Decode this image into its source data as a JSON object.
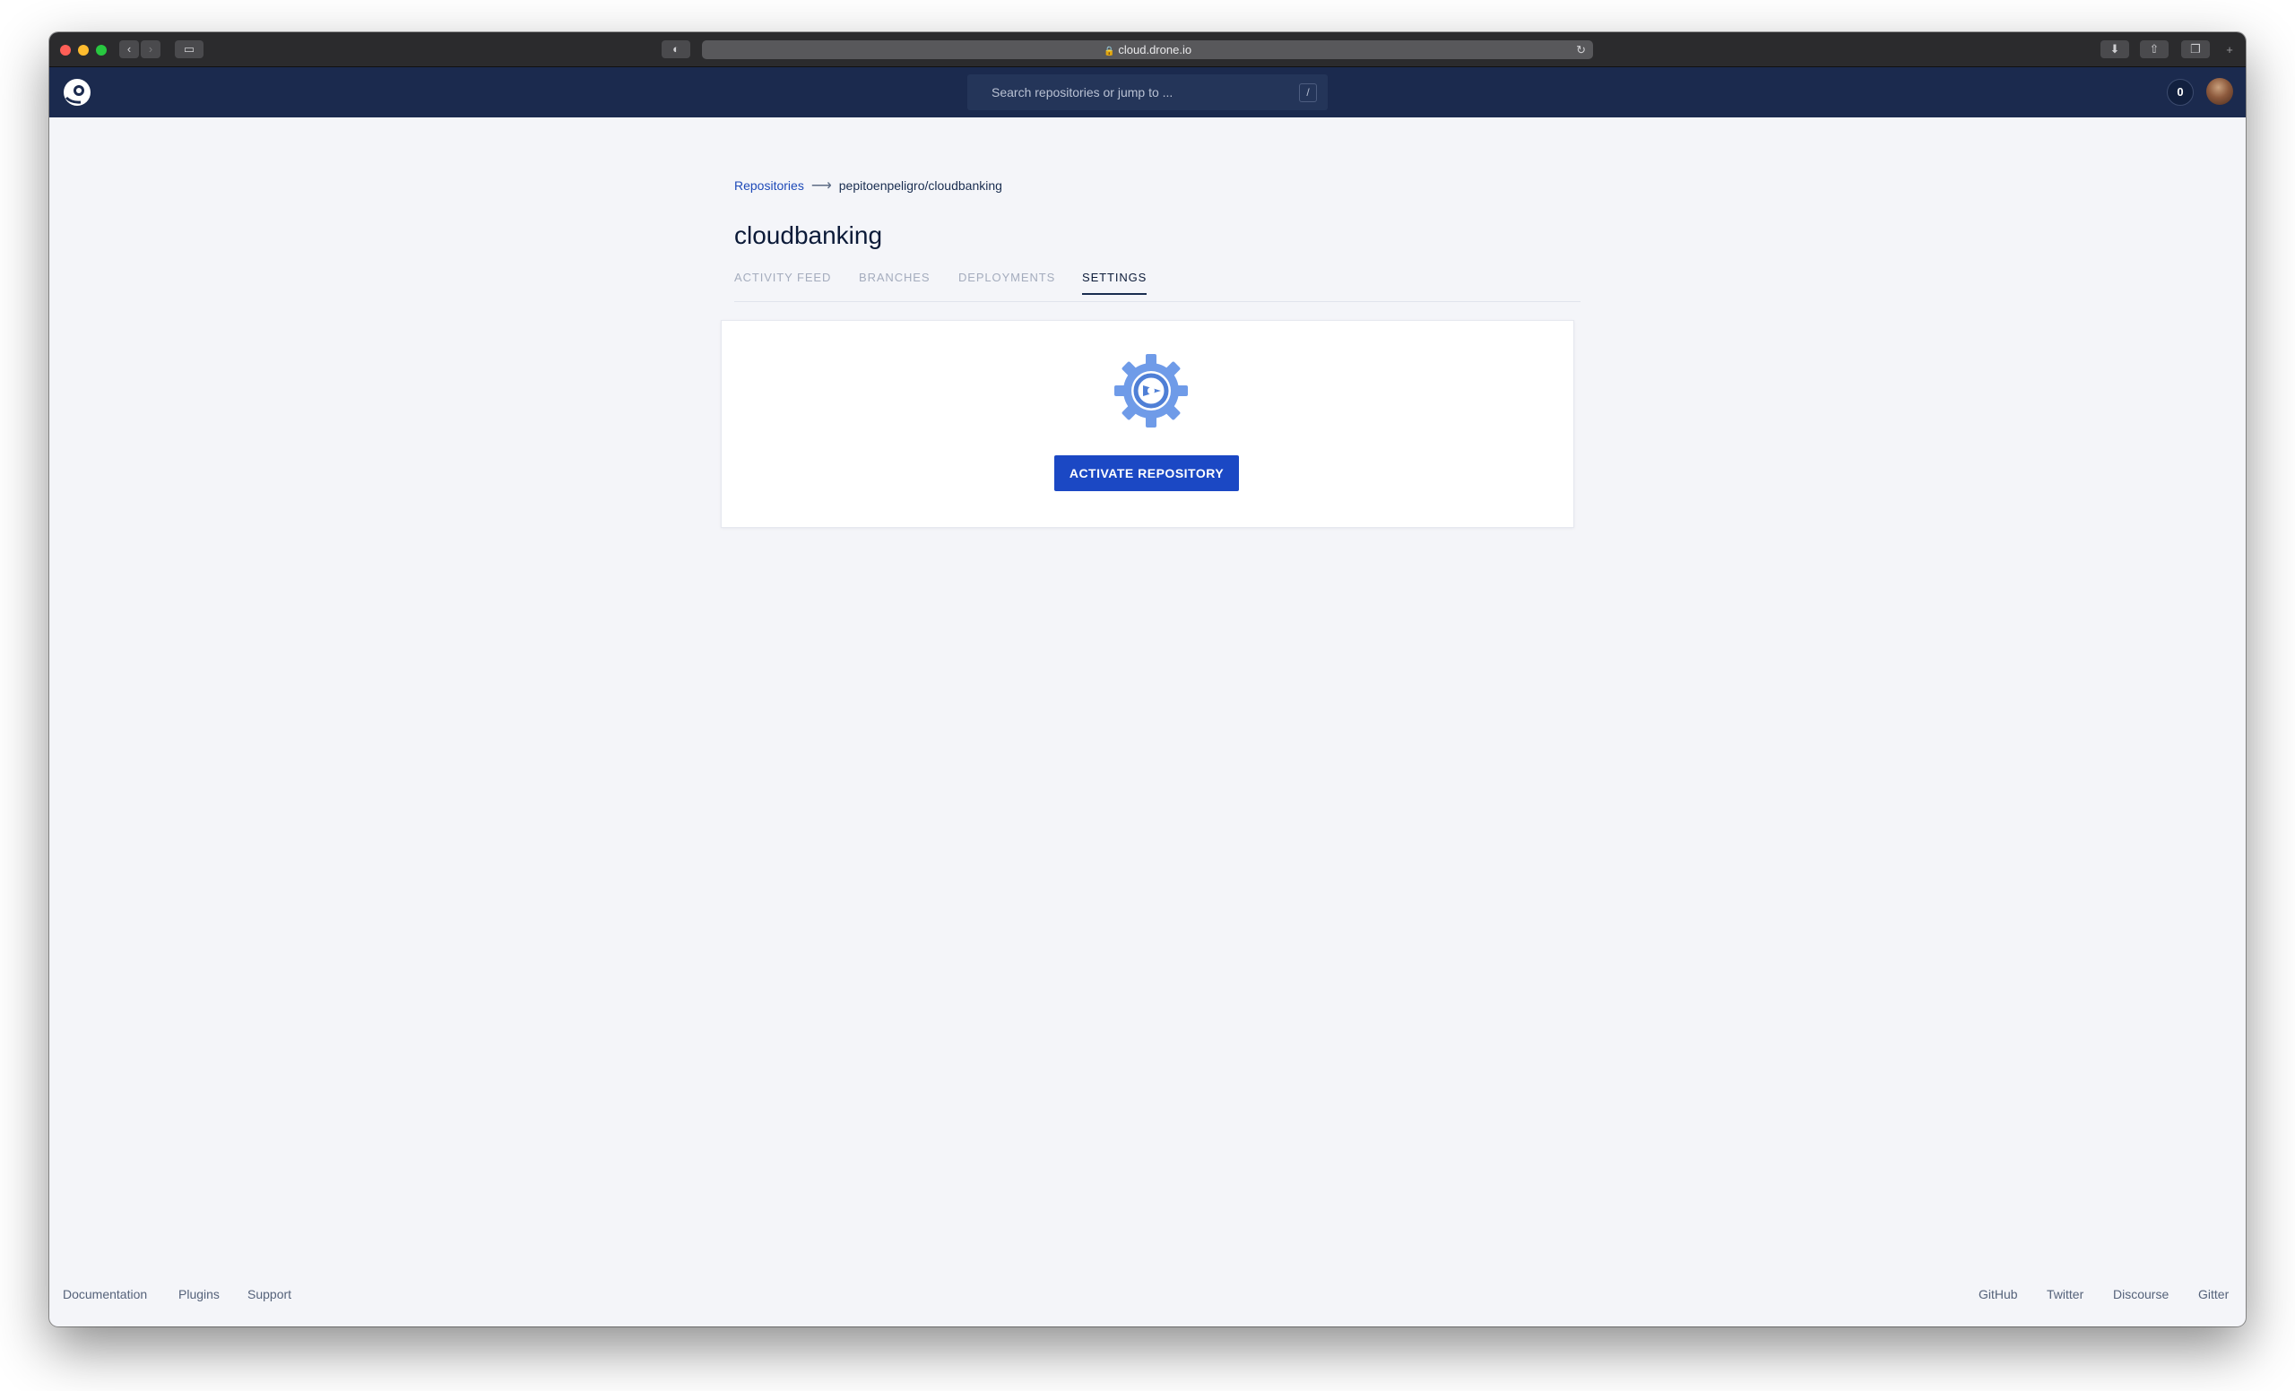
{
  "browser": {
    "url": "cloud.drone.io"
  },
  "header": {
    "search_placeholder": "Search repositories or jump to ...",
    "search_shortcut": "/",
    "notification_count": "0"
  },
  "breadcrumb": {
    "root": "Repositories",
    "current": "pepitoenpeligro/cloudbanking"
  },
  "repo": {
    "title": "cloudbanking"
  },
  "tabs": [
    {
      "label": "ACTIVITY FEED",
      "active": false
    },
    {
      "label": "BRANCHES",
      "active": false
    },
    {
      "label": "DEPLOYMENTS",
      "active": false
    },
    {
      "label": "SETTINGS",
      "active": true
    }
  ],
  "main": {
    "activate_label": "ACTIVATE REPOSITORY"
  },
  "footer": {
    "left": [
      "Documentation",
      "Plugins",
      "Support"
    ],
    "right": [
      "GitHub",
      "Twitter",
      "Discourse",
      "Gitter"
    ]
  },
  "colors": {
    "header_bg": "#1b2a4e",
    "accent": "#1b48c4",
    "page_bg": "#f4f5f9",
    "gear": "#6f9be8"
  }
}
